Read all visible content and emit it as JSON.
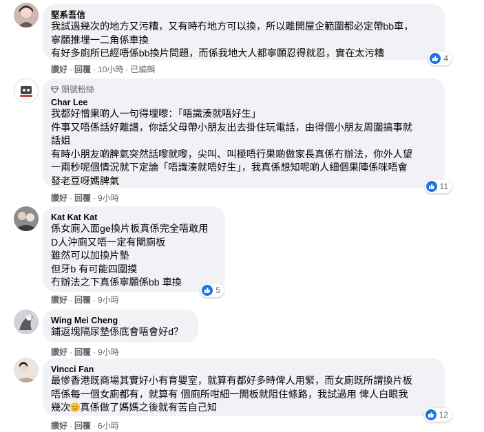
{
  "comments": [
    {
      "author": "堅系吾信",
      "badge": "",
      "lines": [
        "我試過幾次的地方又污糟，又有時冇地方可以換，所以離開屋企範圍都必定帶bb車，",
        "寧願推埋一二角係車換",
        "有好多廁所已經唔係bb換片問題，而係我地大人都寧願忍得就忍，實在太污糟"
      ],
      "reactions": "4",
      "like": "讚好",
      "reply": "回覆",
      "time": "10小時",
      "edited": "已編輯"
    },
    {
      "author": "Char Lee",
      "badge": "頭號粉絲",
      "lines": [
        "我都好憎果啲人一句得埋嚟：「唔識湊就唔好生」",
        "件事又唔係話好離譜，你話父母帶小朋友出去掛住玩電話，由得個小朋友周圍搞事就",
        "話姐",
        "有時小朋友啲脾氣突然話嚟就嚟，尖叫、叫極唔行果啲做家長真係冇辦法，你外人望",
        "一兩秒呢個情況就下定論「唔識湊就唔好生」，我真係想知呢啲人細個果陣係咪唔會",
        "發老豆呀媽脾氣"
      ],
      "reactions": "11",
      "like": "讚好",
      "reply": "回覆",
      "time": "9小時",
      "edited": ""
    },
    {
      "author": "Kat Kat Kat",
      "badge": "",
      "lines": [
        "係女廁入面ge換片板真係完全唔敢用",
        "D人沖廁又唔一定有閘廁板",
        "雖然可以加換片墊",
        "但牙b 有可能四圍摸",
        "冇辦法之下真係寧願係bb 車換"
      ],
      "reactions": "5",
      "like": "讚好",
      "reply": "回覆",
      "time": "9小時",
      "edited": ""
    },
    {
      "author": "Wing Mei Cheng",
      "badge": "",
      "lines": [
        "鋪返塊隔尿墊係底會唔會好d？"
      ],
      "reactions": "",
      "like": "讚好",
      "reply": "回覆",
      "time": "9小時",
      "edited": ""
    },
    {
      "author": "Vincci Fan",
      "badge": "",
      "lines": [
        "最慘香港既商場其實好小有育嬰室，就算有都好多時俾人用緊，而女廁既所謂換片板",
        "唔係每一個女廁都有，就算有 個廁所咁細一開板就阻住條路，我試過用 俾人白眼我",
        "幾次",
        "真係做了媽媽之後就有苦自己知"
      ],
      "reactions": "12",
      "like": "讚好",
      "reply": "回覆",
      "time": "6小時",
      "edited": ""
    }
  ],
  "colors": {
    "bubble": "#f0f2f5",
    "like_blue": "#1b74e4",
    "meta_gray": "#65676b"
  }
}
